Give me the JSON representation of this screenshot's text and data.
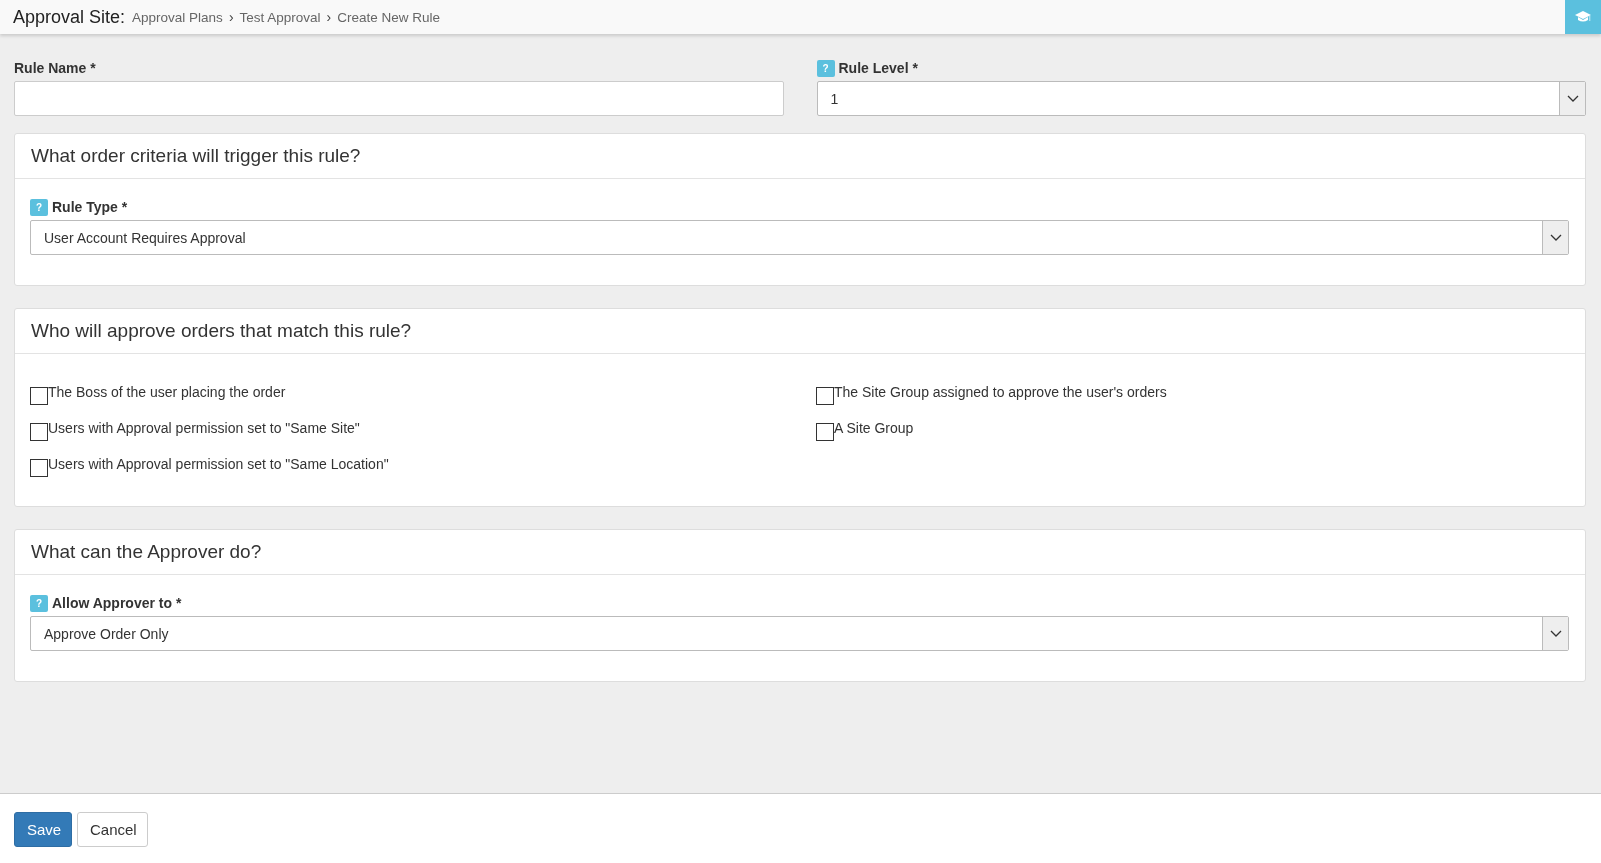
{
  "header": {
    "title": "Approval Site:",
    "breadcrumb": [
      "Approval Plans",
      "Test Approval",
      "Create New Rule"
    ],
    "breadcrumb_separator": "›"
  },
  "rule_name": {
    "label": "Rule Name *"
  },
  "rule_level": {
    "label": "Rule Level *",
    "help": "?",
    "value": "1"
  },
  "panels": [
    {
      "title": "What order criteria will trigger this rule?",
      "kind": "select",
      "field": {
        "label": "Rule Type *",
        "help": "?",
        "value": "User Account Requires Approval"
      }
    },
    {
      "title": "Who will approve orders that match this rule?",
      "kind": "checks",
      "columns": [
        [
          {
            "label": "The Boss of the user placing the order",
            "checked": false
          },
          {
            "label": "Users with Approval permission set to \"Same Site\"",
            "checked": false
          },
          {
            "label": "Users with Approval permission set to \"Same Location\"",
            "checked": false
          }
        ],
        [
          {
            "label": "The Site Group assigned to approve the user's orders",
            "checked": false
          },
          {
            "label": "A Site Group",
            "checked": false
          }
        ]
      ]
    },
    {
      "title": "What can the Approver do?",
      "kind": "select",
      "field": {
        "label": "Allow Approver to *",
        "help": "?",
        "value": "Approve Order Only"
      }
    }
  ],
  "buttons": [
    {
      "label": "Save",
      "kind": "primary"
    },
    {
      "label": "Cancel",
      "kind": "default"
    }
  ]
}
